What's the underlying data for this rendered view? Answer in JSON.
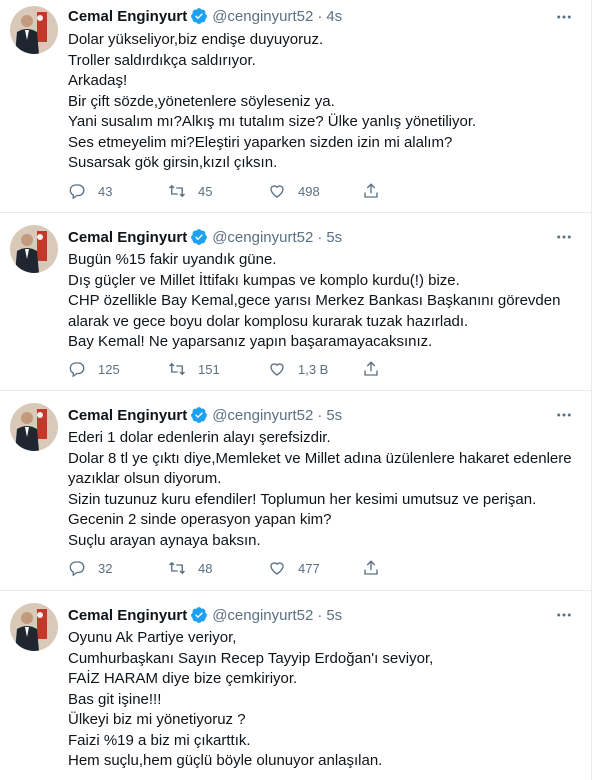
{
  "tweets": [
    {
      "name": "Cemal Enginyurt",
      "handle": "@cenginyurt52",
      "dot": "·",
      "time": "4s",
      "lines": [
        "Dolar yükseliyor,biz endişe duyuyoruz.",
        "Troller saldırdıkça saldırıyor.",
        "Arkadaş!",
        "Bir çift sözde,yönetenlere söyleseniz ya.",
        "Yani susalım mı?Alkış mı tutalım size? Ülke yanlış yönetiliyor.",
        "Ses etmeyelim mi?Eleştiri yaparken sizden izin mi alalım?",
        "Susarsak gök girsin,kızıl çıksın."
      ],
      "replies": "43",
      "retweets": "45",
      "likes": "498"
    },
    {
      "name": "Cemal Enginyurt",
      "handle": "@cenginyurt52",
      "dot": "·",
      "time": "5s",
      "lines": [
        "Bugün %15 fakir uyandık güne.",
        "Dış güçler ve Millet İttifakı kumpas ve komplo kurdu(!) bize.",
        "CHP özellikle Bay Kemal,gece yarısı Merkez Bankası Başkanını görevden",
        "alarak ve gece boyu dolar komplosu kurarak tuzak hazırladı.",
        "Bay Kemal! Ne yaparsanız yapın başaramayacaksınız."
      ],
      "replies": "125",
      "retweets": "151",
      "likes": "1,3 B"
    },
    {
      "name": "Cemal Enginyurt",
      "handle": "@cenginyurt52",
      "dot": "·",
      "time": "5s",
      "lines": [
        "Ederi 1 dolar edenlerin alayı şerefsizdir.",
        "Dolar 8 tl ye çıktı diye,Memleket ve Millet adına üzülenlere hakaret edenlere",
        "yazıklar olsun diyorum.",
        "Sizin tuzunuz kuru efendiler! Toplumun her kesimi umutsuz ve perişan.",
        "Gecenin 2 sinde operasyon yapan kim?",
        "Suçlu arayan aynaya baksın."
      ],
      "replies": "32",
      "retweets": "48",
      "likes": "477"
    },
    {
      "name": "Cemal Enginyurt",
      "handle": "@cenginyurt52",
      "dot": "·",
      "time": "5s",
      "lines": [
        "Oyunu Ak Partiye veriyor,",
        "Cumhurbaşkanı Sayın Recep Tayyip Erdoğan'ı seviyor,",
        "FAİZ HARAM  diye bize çemkiriyor.",
        "Bas git işine!!!",
        "Ülkeyi biz mi yönetiyoruz ?",
        "Faizi %19 a biz mi çıkarttık.",
        "Hem suçlu,hem güçlü böyle olunuyor anlaşılan."
      ]
    }
  ]
}
